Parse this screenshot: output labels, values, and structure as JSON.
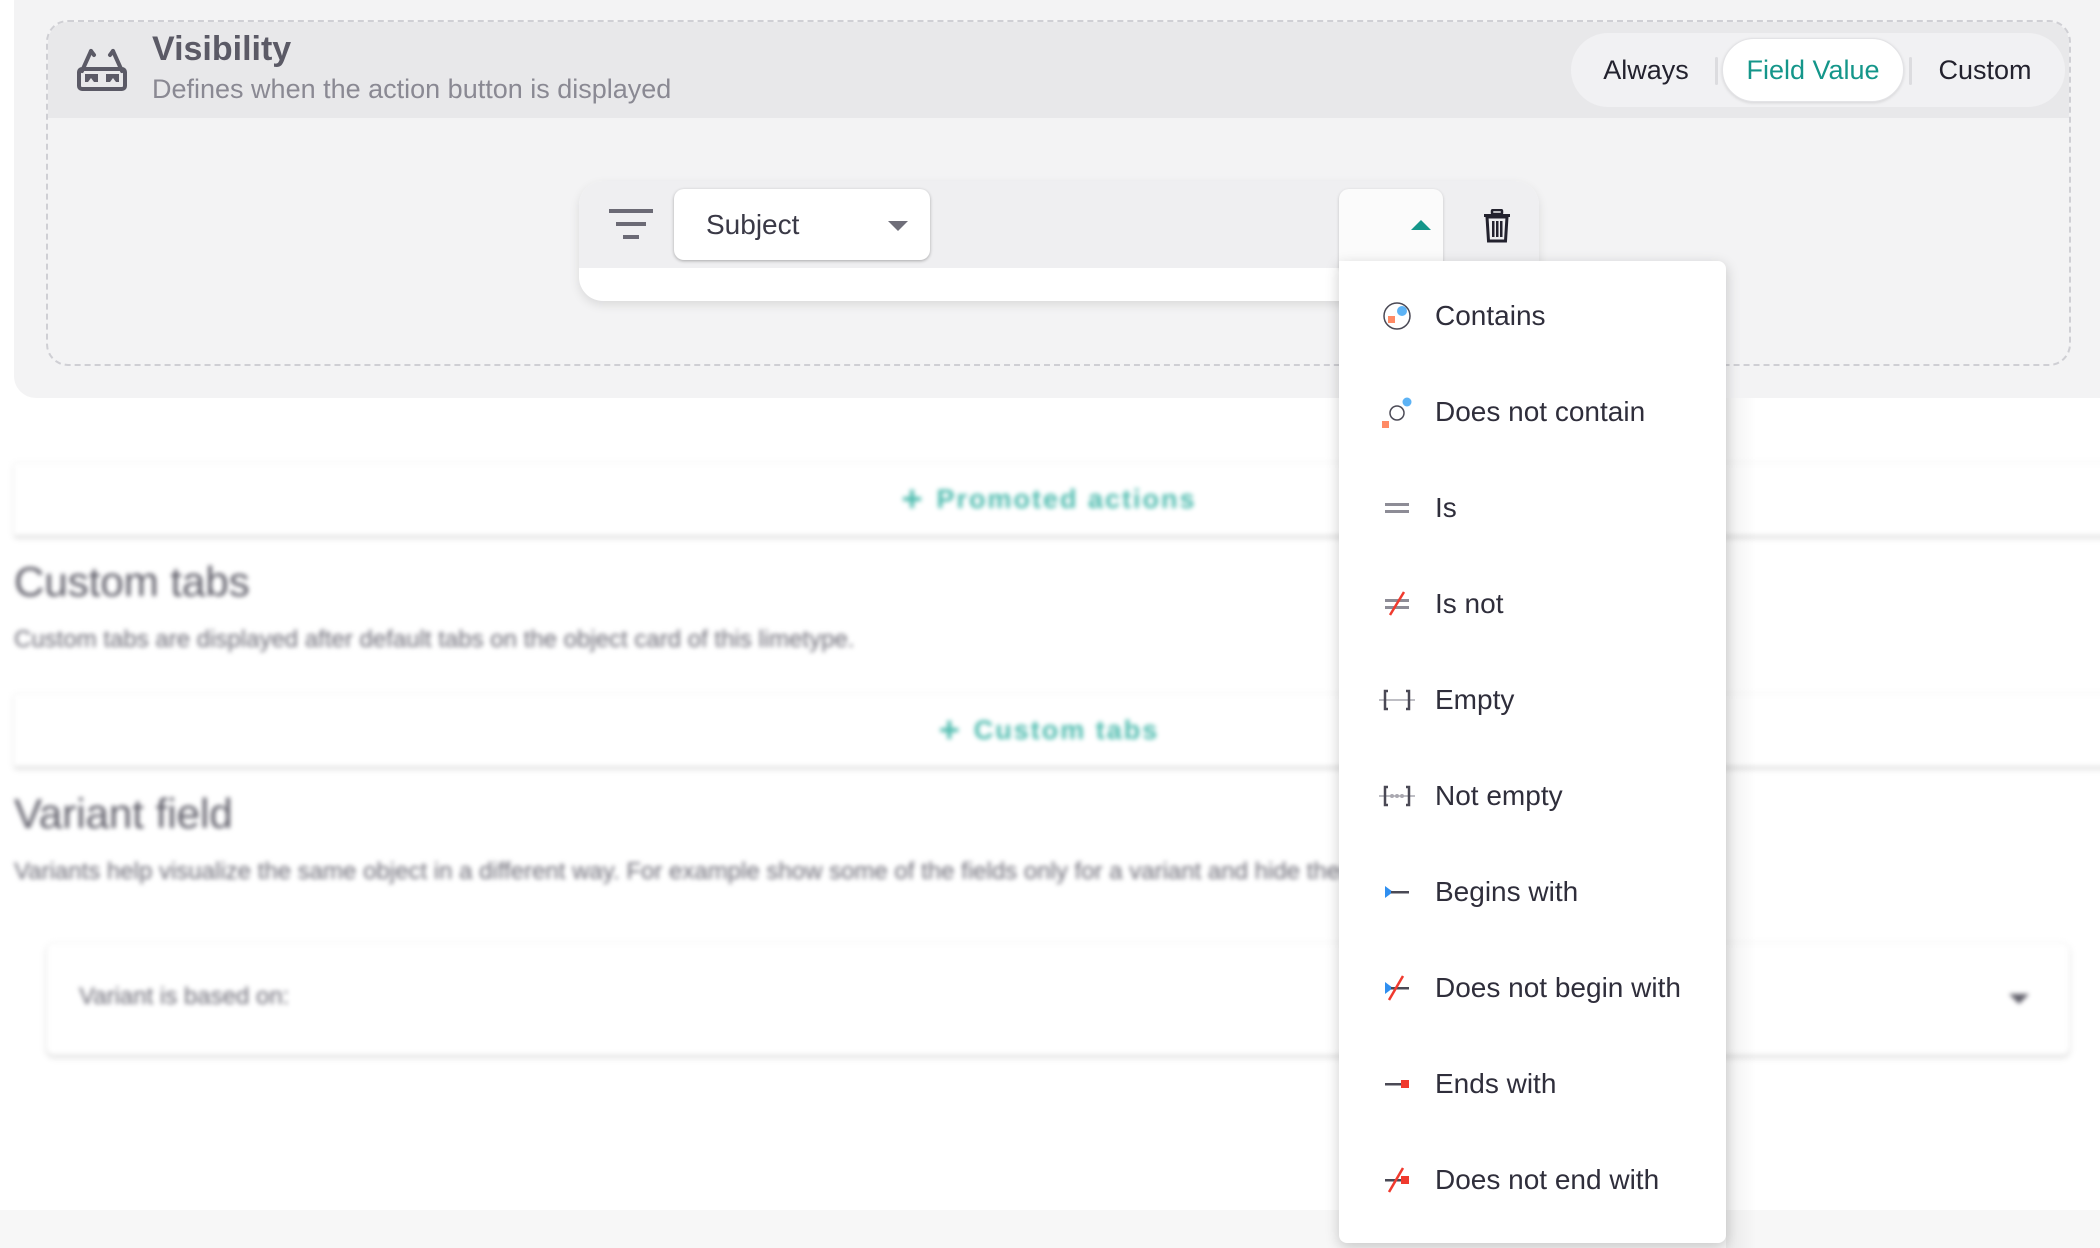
{
  "visibility": {
    "icon": "3d-glasses-icon",
    "title": "Visibility",
    "description": "Defines when the action button is displayed",
    "modes": [
      {
        "label": "Always",
        "selected": false
      },
      {
        "label": "Field Value",
        "selected": true
      },
      {
        "label": "Custom",
        "selected": false
      }
    ]
  },
  "filter": {
    "filter_icon": "filter-lines-icon",
    "field_select": {
      "value": "Subject",
      "icon": "caret-down-icon"
    },
    "operator_select": {
      "value": "",
      "open": true,
      "icon": "caret-up-icon"
    },
    "delete_icon": "trash-icon"
  },
  "operator_menu": {
    "items": [
      {
        "label": "Contains",
        "icon": "contains-icon"
      },
      {
        "label": "Does not contain",
        "icon": "does-not-contain-icon"
      },
      {
        "label": "Is",
        "icon": "equals-icon"
      },
      {
        "label": "Is not",
        "icon": "not-equals-icon"
      },
      {
        "label": "Empty",
        "icon": "empty-brackets-icon"
      },
      {
        "label": "Not empty",
        "icon": "not-empty-brackets-icon"
      },
      {
        "label": "Begins with",
        "icon": "begins-with-icon"
      },
      {
        "label": "Does not begin with",
        "icon": "does-not-begin-with-icon"
      },
      {
        "label": "Ends with",
        "icon": "ends-with-icon"
      },
      {
        "label": "Does not end with",
        "icon": "does-not-end-with-icon"
      }
    ]
  },
  "background": {
    "promoted_actions_button": "Promoted actions",
    "custom_tabs": {
      "title": "Custom tabs",
      "description": "Custom tabs are displayed after default tabs on the object card of this limetype.",
      "add_button": "Custom tabs"
    },
    "variant_field": {
      "title": "Variant field",
      "description": "Variants help visualize the same object in a different way. For example show some of the fields only for a variant and hide them for another variant.",
      "select_label": "Variant is based on:"
    }
  },
  "colors": {
    "accent": "#14968a",
    "accent_light": "#4dbbae",
    "danger": "#f03a2e",
    "info": "#3aa0f0",
    "orange": "#ff8a65"
  }
}
